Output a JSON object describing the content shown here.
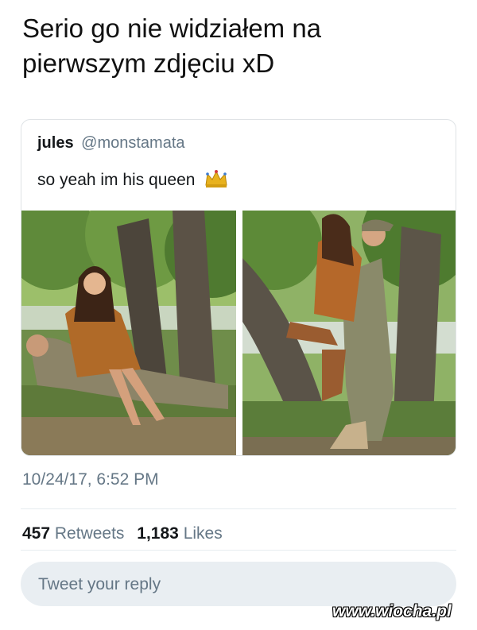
{
  "caption": {
    "line1": "Serio go nie widziałem na",
    "line2": "pierwszym zdjęciu xD"
  },
  "quoted_tweet": {
    "name": "jules",
    "handle": "@monstamata",
    "text": "so yeah im his queen",
    "emoji_icon": "crown-icon",
    "photos": [
      {
        "alt": "photo-left"
      },
      {
        "alt": "photo-right"
      }
    ]
  },
  "timestamp": "10/24/17, 6:52 PM",
  "stats": {
    "retweets_count": "457",
    "retweets_label": "Retweets",
    "likes_count": "1,183",
    "likes_label": "Likes"
  },
  "reply": {
    "placeholder": "Tweet your reply"
  },
  "watermark": "www.wiocha.pl",
  "colors": {
    "text": "#14171a",
    "secondary": "#657786",
    "border": "#dfe3e6",
    "reply_bg": "#e9eef2"
  }
}
